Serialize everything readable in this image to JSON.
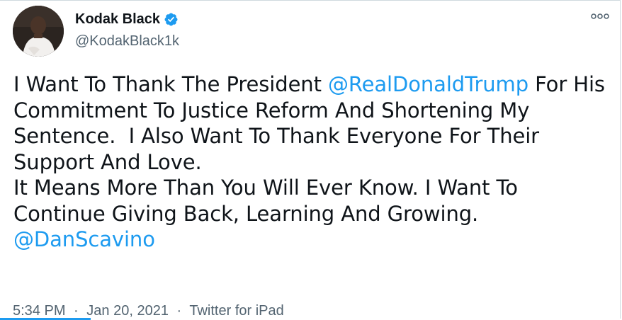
{
  "tweet": {
    "author": {
      "display_name": "Kodak Black",
      "handle": "@KodakBlack1k",
      "verified": true
    },
    "text_parts": [
      {
        "type": "text",
        "value": "I Want To Thank The President "
      },
      {
        "type": "mention",
        "value": "@RealDonaldTrump"
      },
      {
        "type": "text",
        "value": " For His Commitment To Justice Reform And Shortening My Sentence.  I Also Want To Thank Everyone For Their Support And Love.\nIt Means More Than You Will Ever Know. I Want To Continue Giving Back, Learning And Growing.\n"
      },
      {
        "type": "mention",
        "value": "@DanScavino"
      }
    ],
    "time": "5:34 PM",
    "date": "Jan 20, 2021",
    "source": "Twitter for iPad",
    "separator": "·"
  },
  "colors": {
    "accent": "#1d9bf0",
    "text_primary": "#0f1419",
    "text_secondary": "#536471"
  },
  "icons": {
    "verified": "verified-badge-icon",
    "more": "more-options-icon"
  }
}
